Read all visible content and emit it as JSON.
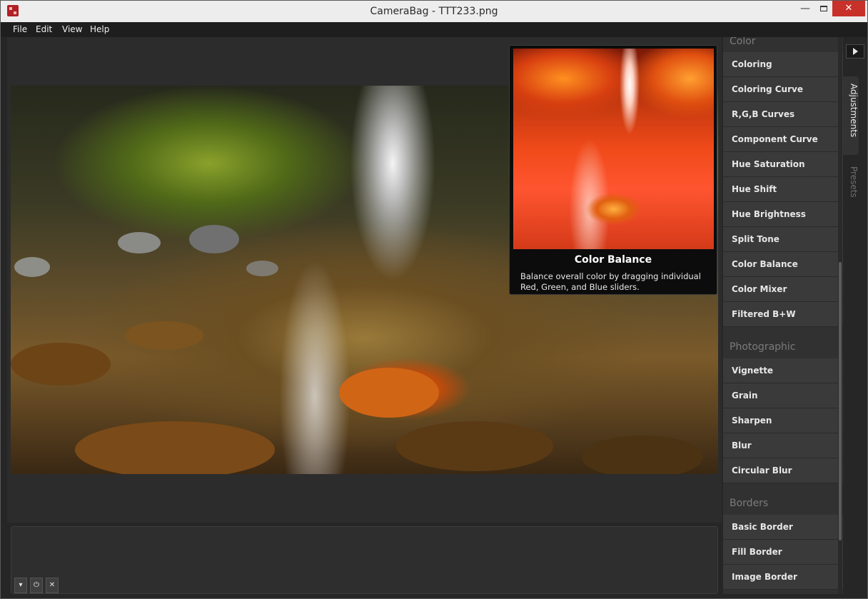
{
  "window": {
    "title": "CameraBag - TTT233.png",
    "controls": {
      "minimize": "—",
      "close": "✕"
    }
  },
  "menu": [
    "File",
    "Edit",
    "View",
    "Help"
  ],
  "tooltip": {
    "title": "Color Balance",
    "description": "Balance overall color by dragging individual Red, Green, and Blue sliders."
  },
  "sidebar": {
    "sections": [
      {
        "title": "Color",
        "items": [
          "Coloring",
          "Coloring Curve",
          "R,G,B Curves",
          "Component Curve",
          "Hue Saturation",
          "Hue Shift",
          "Hue Brightness",
          "Split Tone",
          "Color Balance",
          "Color Mixer",
          "Filtered B+W"
        ]
      },
      {
        "title": "Photographic",
        "items": [
          "Vignette",
          "Grain",
          "Sharpen",
          "Blur",
          "Circular Blur"
        ]
      },
      {
        "title": "Borders",
        "items": [
          "Basic Border",
          "Fill Border",
          "Image Border"
        ]
      }
    ]
  },
  "tabs": [
    "Adjustments",
    "Presets"
  ],
  "bottom_toolbar": {
    "expand": "▾",
    "power": "⏻",
    "close": "✕"
  }
}
